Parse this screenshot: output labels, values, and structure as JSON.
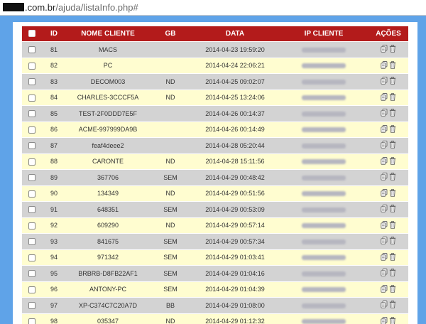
{
  "browser": {
    "url_domain": ".com.br",
    "url_path": "/ajuda/listaInfo.php#"
  },
  "table": {
    "headers": {
      "id": "ID",
      "nome": "NOME CLIENTE",
      "gb": "GB",
      "data": "DATA",
      "ip": "IP CLIENTE",
      "acoes": "AÇÕES"
    },
    "rows": [
      {
        "id": "81",
        "nome": "MACS",
        "gb": "",
        "data": "2014-04-23 19:59:20"
      },
      {
        "id": "82",
        "nome": "PC",
        "gb": "",
        "data": "2014-04-24 22:06:21"
      },
      {
        "id": "83",
        "nome": "DECOM003",
        "gb": "ND",
        "data": "2014-04-25 09:02:07"
      },
      {
        "id": "84",
        "nome": "CHARLES-3CCCF5A",
        "gb": "ND",
        "data": "2014-04-25 13:24:06"
      },
      {
        "id": "85",
        "nome": "TEST-2F0DDD7E5F",
        "gb": "",
        "data": "2014-04-26 00:14:37"
      },
      {
        "id": "86",
        "nome": "ACME-997999DA9B",
        "gb": "",
        "data": "2014-04-26 00:14:49"
      },
      {
        "id": "87",
        "nome": "feaf4deee2",
        "gb": "",
        "data": "2014-04-28 05:20:44"
      },
      {
        "id": "88",
        "nome": "CARONTE",
        "gb": "ND",
        "data": "2014-04-28 15:11:56"
      },
      {
        "id": "89",
        "nome": "367706",
        "gb": "SEM",
        "data": "2014-04-29 00:48:42"
      },
      {
        "id": "90",
        "nome": "134349",
        "gb": "ND",
        "data": "2014-04-29 00:51:56"
      },
      {
        "id": "91",
        "nome": "648351",
        "gb": "SEM",
        "data": "2014-04-29 00:53:09"
      },
      {
        "id": "92",
        "nome": "609290",
        "gb": "ND",
        "data": "2014-04-29 00:57:14"
      },
      {
        "id": "93",
        "nome": "841675",
        "gb": "SEM",
        "data": "2014-04-29 00:57:34"
      },
      {
        "id": "94",
        "nome": "971342",
        "gb": "SEM",
        "data": "2014-04-29 01:03:41"
      },
      {
        "id": "95",
        "nome": "BRBRB-D8FB22AF1",
        "gb": "SEM",
        "data": "2014-04-29 01:04:16"
      },
      {
        "id": "96",
        "nome": "ANTONY-PC",
        "gb": "SEM",
        "data": "2014-04-29 01:04:39"
      },
      {
        "id": "97",
        "nome": "XP-C374C7C20A7D",
        "gb": "BB",
        "data": "2014-04-29 01:08:00"
      },
      {
        "id": "98",
        "nome": "035347",
        "gb": "ND",
        "data": "2014-04-29 01:12:32"
      }
    ]
  },
  "icons": {
    "copy": "copy-icon",
    "delete": "trash-icon"
  },
  "colors": {
    "header_bg": "#b31b1b",
    "row_gray": "#d3d3d3",
    "row_cream": "#fffdd0",
    "page_bg": "#5fa3e8"
  }
}
